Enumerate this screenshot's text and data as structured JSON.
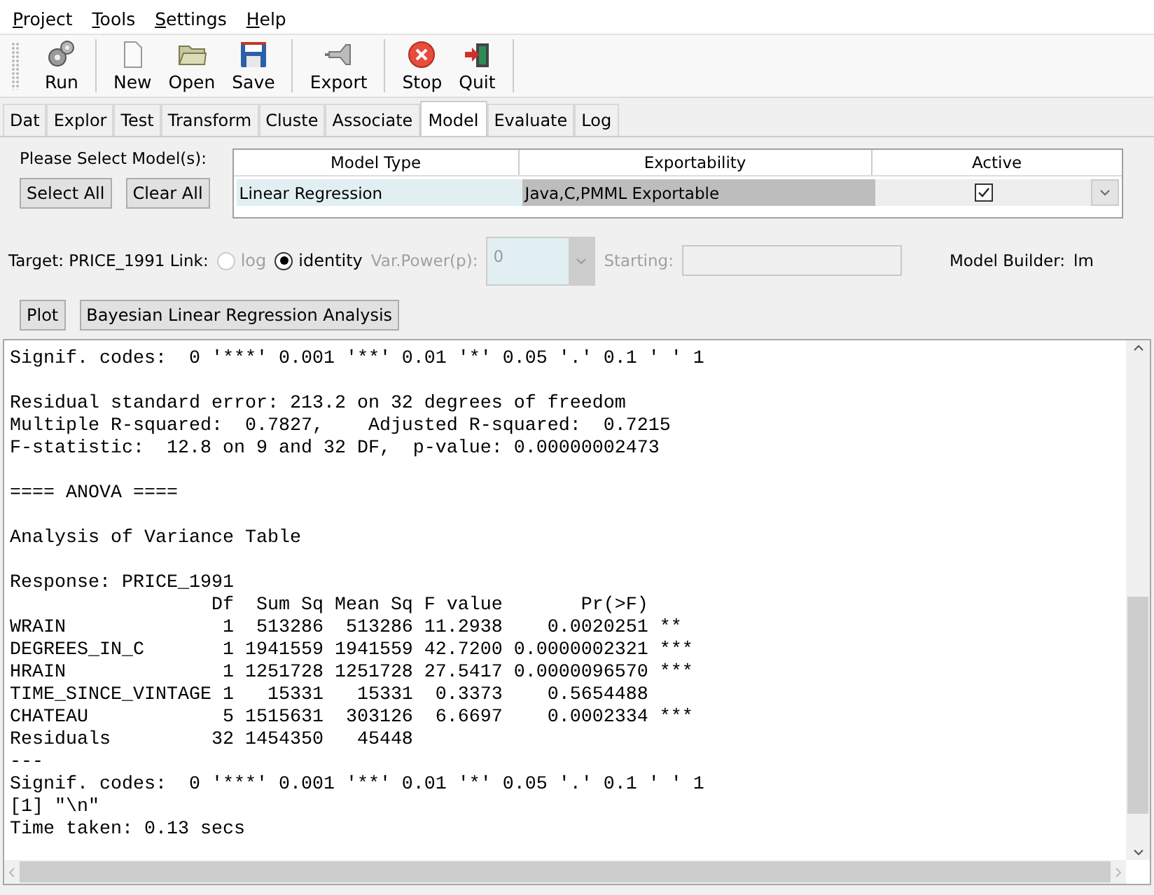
{
  "menu": [
    "Project",
    "Tools",
    "Settings",
    "Help"
  ],
  "toolbar": [
    [
      {
        "kind": "run",
        "label": "Run"
      }
    ],
    [
      {
        "kind": "new",
        "label": "New"
      },
      {
        "kind": "open",
        "label": "Open"
      },
      {
        "kind": "save",
        "label": "Save"
      }
    ],
    [
      {
        "kind": "export",
        "label": "Export"
      }
    ],
    [
      {
        "kind": "stop",
        "label": "Stop"
      },
      {
        "kind": "quit",
        "label": "Quit"
      }
    ]
  ],
  "tabs": [
    {
      "label": "Dat",
      "selected": false
    },
    {
      "label": "Explor",
      "selected": false
    },
    {
      "label": "Test",
      "selected": false
    },
    {
      "label": "Transform",
      "selected": false
    },
    {
      "label": "Cluste",
      "selected": false
    },
    {
      "label": "Associate",
      "selected": false
    },
    {
      "label": "Model",
      "selected": true
    },
    {
      "label": "Evaluate",
      "selected": false
    },
    {
      "label": "Log",
      "selected": false
    }
  ],
  "model_select": {
    "label": "Please Select Model(s):",
    "buttons": [
      "Select All",
      "Clear All"
    ],
    "columns": [
      "Model Type",
      "Exportability",
      "Active"
    ],
    "rows": [
      {
        "model_type": "Linear Regression",
        "exportability": "Java,C,PMML Exportable",
        "active": true
      }
    ]
  },
  "options": {
    "target": "Target: PRICE_1991 Link:",
    "link": [
      {
        "label": "log",
        "selected": false,
        "disabled": true
      },
      {
        "label": "identity",
        "selected": true,
        "disabled": false
      }
    ],
    "var_power": {
      "label": "Var.Power(p):",
      "value": "0",
      "disabled": true
    },
    "starting": {
      "label": "Starting:",
      "disabled": true
    },
    "builder_label": "Model Builder:",
    "builder": "lm"
  },
  "actions": [
    "Plot",
    "Bayesian Linear Regression Analysis"
  ],
  "output": [
    [
      "Signif. codes:  0 '***' 0.001 '**' 0.01 '*' 0.05 '.' 0.1 ' ' 1"
    ],
    [
      "Residual standard error: 213.2 on 32 degrees of freedom",
      "Multiple R-squared:  0.7827,    Adjusted R-squared:  0.7215",
      "F-statistic:  12.8 on 9 and 32 DF,  p-value: 0.00000002473"
    ],
    [
      "==== ANOVA ===="
    ],
    [
      "Analysis of Variance Table"
    ],
    [
      "Response: PRICE_1991",
      "                  Df  Sum Sq Mean Sq F value       Pr(>F)    ",
      "WRAIN              1  513286  513286 11.2938    0.0020251 ** ",
      "DEGREES_IN_C       1 1941559 1941559 42.7200 0.0000002321 ***",
      "HRAIN              1 1251728 1251728 27.5417 0.0000096570 ***",
      "TIME_SINCE_VINTAGE 1   15331   15331  0.3373    0.5654488    ",
      "CHATEAU            5 1515631  303126  6.6697    0.0002334 ***",
      "Residuals         32 1454350   45448",
      "---",
      "Signif. codes:  0 '***' 0.001 '**' 0.01 '*' 0.05 '.' 0.1 ' ' 1",
      "[1] \"\\n\"",
      "Time taken: 0.13 secs"
    ]
  ]
}
